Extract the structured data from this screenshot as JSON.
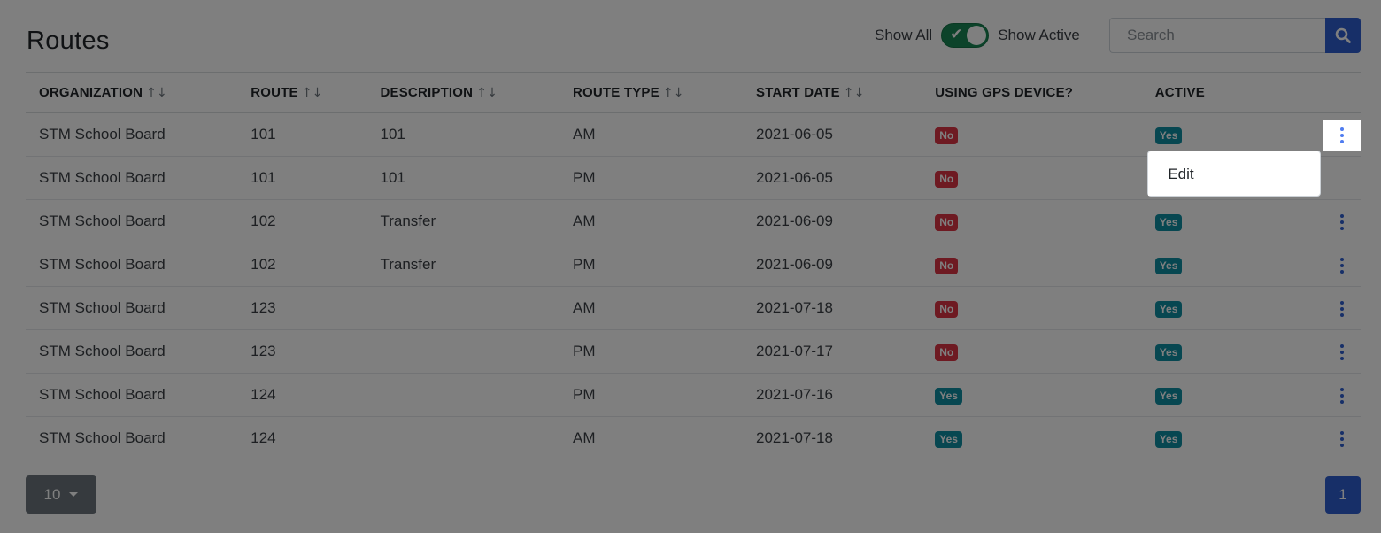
{
  "page": {
    "title": "Routes"
  },
  "filters": {
    "show_all_label": "Show All",
    "show_active_label": "Show Active",
    "toggle_on": true,
    "toggle_check_glyph": "✔"
  },
  "search": {
    "placeholder": "Search",
    "value": "",
    "icon": "search-icon"
  },
  "table": {
    "sort_glyph": "↑↓",
    "columns": [
      {
        "label": "ORGANIZATION",
        "sortable": true
      },
      {
        "label": "ROUTE",
        "sortable": true
      },
      {
        "label": "DESCRIPTION",
        "sortable": true
      },
      {
        "label": "ROUTE TYPE",
        "sortable": true
      },
      {
        "label": "START DATE",
        "sortable": true
      },
      {
        "label": "USING GPS DEVICE?",
        "sortable": false
      },
      {
        "label": "ACTIVE",
        "sortable": false
      }
    ],
    "rows": [
      {
        "organization": "STM School Board",
        "route": "101",
        "description": "101",
        "route_type": "AM",
        "start_date": "2021-06-05",
        "gps": "No",
        "active": "Yes"
      },
      {
        "organization": "STM School Board",
        "route": "101",
        "description": "101",
        "route_type": "PM",
        "start_date": "2021-06-05",
        "gps": "No",
        "active": ""
      },
      {
        "organization": "STM School Board",
        "route": "102",
        "description": "Transfer",
        "route_type": "AM",
        "start_date": "2021-06-09",
        "gps": "No",
        "active": "Yes"
      },
      {
        "organization": "STM School Board",
        "route": "102",
        "description": "Transfer",
        "route_type": "PM",
        "start_date": "2021-06-09",
        "gps": "No",
        "active": "Yes"
      },
      {
        "organization": "STM School Board",
        "route": "123",
        "description": "",
        "route_type": "AM",
        "start_date": "2021-07-18",
        "gps": "No",
        "active": "Yes"
      },
      {
        "organization": "STM School Board",
        "route": "123",
        "description": "",
        "route_type": "PM",
        "start_date": "2021-07-17",
        "gps": "No",
        "active": "Yes"
      },
      {
        "organization": "STM School Board",
        "route": "124",
        "description": "",
        "route_type": "PM",
        "start_date": "2021-07-16",
        "gps": "Yes",
        "active": "Yes"
      },
      {
        "organization": "STM School Board",
        "route": "124",
        "description": "",
        "route_type": "AM",
        "start_date": "2021-07-18",
        "gps": "Yes",
        "active": "Yes"
      }
    ]
  },
  "row_menu": {
    "open_row": 0,
    "items": [
      {
        "label": "Edit"
      }
    ]
  },
  "pagination": {
    "page_size": "10",
    "current_page": "1"
  },
  "colors": {
    "primary": "#2f5fd0",
    "toggle_on": "#198754",
    "badge_no": "#dc3545",
    "badge_yes": "#0f8ea3",
    "page_size_button": "#6c757d",
    "modal_backdrop": "rgba(0,0,0,0.5)"
  }
}
